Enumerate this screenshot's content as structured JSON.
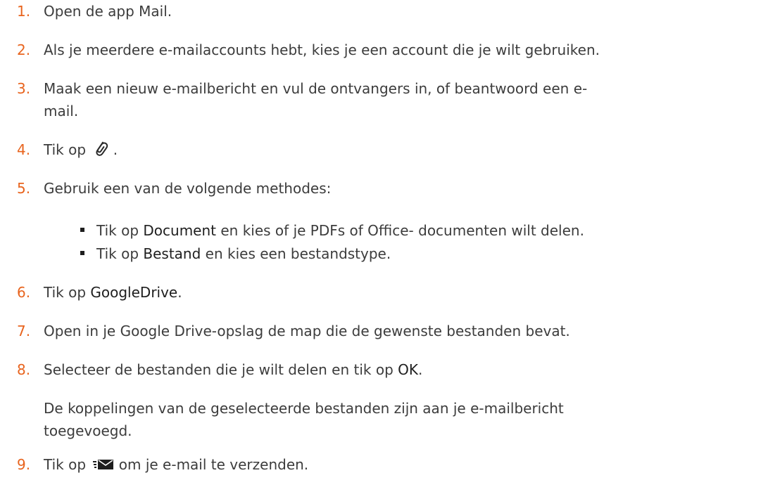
{
  "steps": [
    {
      "number": "1.",
      "text": "Open de app Mail."
    },
    {
      "number": "2.",
      "text": "Als je meerdere e-mailaccounts hebt, kies je een account die je wilt gebruiken."
    },
    {
      "number": "3.",
      "line1": "Maak een nieuw e-mailbericht en vul de ontvangers in, of beantwoord een e-",
      "line2": "mail."
    },
    {
      "number": "4.",
      "before": "Tik op",
      "after": ".",
      "icon": "paperclip-icon"
    },
    {
      "number": "5.",
      "text": "Gebruik een van de volgende methodes:"
    },
    {
      "number": "6.",
      "before": "Tik op",
      "bold": "GoogleDrive",
      "after": "."
    },
    {
      "number": "7.",
      "text": "Open in je Google Drive-opslag de map die de gewenste bestanden bevat."
    },
    {
      "number": "8.",
      "before": "Selecteer de bestanden die je wilt delen en tik op",
      "bold": "OK",
      "after": "."
    },
    {
      "number": "9.",
      "before": "Tik op",
      "after": "om je e-mail te verzenden.",
      "icon": "send-mail-icon"
    }
  ],
  "bullets": [
    {
      "before": "Tik op",
      "bold": "Document",
      "after": "en kies of je PDFs of Office- documenten wilt delen."
    },
    {
      "before": "Tik op",
      "bold": "Bestand",
      "after": "en kies een bestandstype."
    }
  ],
  "result": {
    "line1": "De koppelingen van de geselecteerde bestanden zijn aan je e-mailbericht",
    "line2": "toegevoegd."
  },
  "colors": {
    "number": "#e8641e",
    "text": "#3c3c3c",
    "emphasis": "#1e1e1e"
  }
}
